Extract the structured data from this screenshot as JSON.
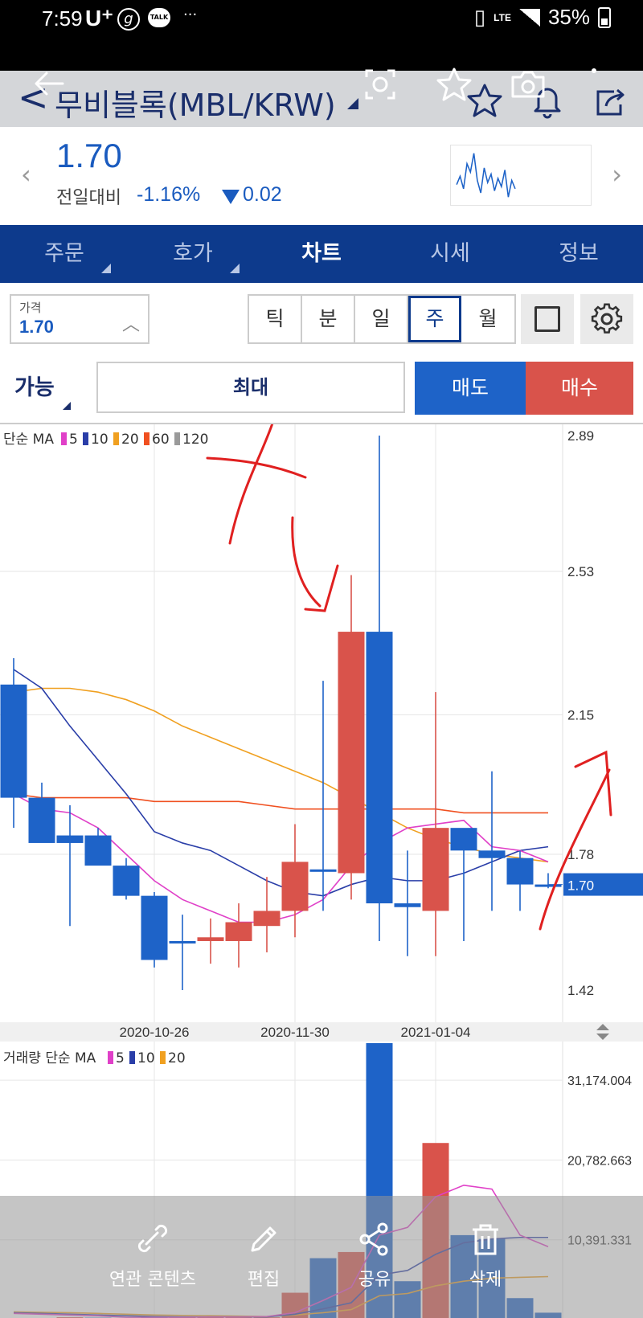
{
  "status_bar": {
    "time": "7:59",
    "carrier": "U⁺",
    "g_icon": "g",
    "talk": "TALK",
    "more": "···",
    "net": "LTE",
    "battery": "35%"
  },
  "header": {
    "title": "무비블록(MBL/KRW)"
  },
  "price": {
    "current": "1.70",
    "change_label": "전일대비",
    "change_pct": "-1.16%",
    "change_value": "0.02"
  },
  "mini_chart": [
    1.78,
    1.82,
    1.76,
    1.88,
    1.84,
    1.93,
    1.8,
    1.74,
    1.86,
    1.79,
    1.83,
    1.75,
    1.81,
    1.77,
    1.85,
    1.72,
    1.8,
    1.76
  ],
  "tabs": [
    {
      "label": "주문",
      "corner": true
    },
    {
      "label": "호가",
      "corner": true
    },
    {
      "label": "차트",
      "active": true
    },
    {
      "label": "시세"
    },
    {
      "label": "정보"
    }
  ],
  "controls": {
    "price_label": "가격",
    "price_value": "1.70",
    "periods": [
      "틱",
      "분",
      "일",
      "주",
      "월"
    ],
    "active_period": "주"
  },
  "order": {
    "available": "가능",
    "max": "최대",
    "sell": "매도",
    "buy": "매수"
  },
  "colors": {
    "up": "#d9534b",
    "down": "#1e63c8",
    "ma5": "#e040c8",
    "ma10": "#2a3ea8",
    "ma20": "#f0a020",
    "ma60": "#f05020",
    "ma120": "#9a9a9a",
    "brand": "#0d3a8c"
  },
  "chart_data": {
    "type": "candlestick",
    "price_panel": {
      "legend": {
        "prefix": "단순 MA",
        "items": [
          {
            "label": "5",
            "color": "#e040c8"
          },
          {
            "label": "10",
            "color": "#2a3ea8"
          },
          {
            "label": "20",
            "color": "#f0a020"
          },
          {
            "label": "60",
            "color": "#f05020"
          },
          {
            "label": "120",
            "color": "#9a9a9a"
          }
        ]
      },
      "y_ticks": [
        "2.89",
        "2.53",
        "2.15",
        "1.78",
        "1.42"
      ],
      "ylim": [
        1.42,
        2.89
      ],
      "current_label": "1.70",
      "x_ticks": [
        "2020-10-26",
        "2020-11-30",
        "2021-01-04"
      ],
      "candles": [
        {
          "o": 2.23,
          "h": 2.3,
          "l": 1.85,
          "c": 1.93
        },
        {
          "o": 1.93,
          "h": 1.97,
          "l": 1.82,
          "c": 1.81
        },
        {
          "o": 1.83,
          "h": 1.91,
          "l": 1.59,
          "c": 1.81
        },
        {
          "o": 1.83,
          "h": 1.85,
          "l": 1.76,
          "c": 1.75
        },
        {
          "o": 1.75,
          "h": 1.77,
          "l": 1.66,
          "c": 1.67
        },
        {
          "o": 1.67,
          "h": 1.68,
          "l": 1.48,
          "c": 1.5
        },
        {
          "o": 1.55,
          "h": 1.62,
          "l": 1.42,
          "c": 1.55
        },
        {
          "o": 1.55,
          "h": 1.61,
          "l": 1.49,
          "c": 1.56
        },
        {
          "o": 1.55,
          "h": 1.65,
          "l": 1.48,
          "c": 1.6
        },
        {
          "o": 1.59,
          "h": 1.72,
          "l": 1.52,
          "c": 1.63
        },
        {
          "o": 1.63,
          "h": 1.86,
          "l": 1.56,
          "c": 1.76
        },
        {
          "o": 1.74,
          "h": 2.24,
          "l": 1.63,
          "c": 1.74
        },
        {
          "o": 1.73,
          "h": 2.52,
          "l": 1.66,
          "c": 2.37
        },
        {
          "o": 2.37,
          "h": 2.89,
          "l": 1.55,
          "c": 1.65
        },
        {
          "o": 1.65,
          "h": 1.79,
          "l": 1.51,
          "c": 1.64
        },
        {
          "o": 1.63,
          "h": 2.21,
          "l": 1.51,
          "c": 1.85
        },
        {
          "o": 1.85,
          "h": 1.84,
          "l": 1.55,
          "c": 1.79
        },
        {
          "o": 1.79,
          "h": 2.0,
          "l": 1.63,
          "c": 1.77
        },
        {
          "o": 1.77,
          "h": 1.79,
          "l": 1.63,
          "c": 1.7
        },
        {
          "o": 1.7,
          "h": 1.73,
          "l": 1.69,
          "c": 1.7
        }
      ],
      "ma5": [
        1.94,
        1.9,
        1.89,
        1.85,
        1.78,
        1.71,
        1.66,
        1.63,
        1.6,
        1.6,
        1.62,
        1.66,
        1.75,
        1.81,
        1.85,
        1.86,
        1.87,
        1.8,
        1.79,
        1.76
      ],
      "ma10": [
        2.27,
        2.22,
        2.12,
        2.03,
        1.94,
        1.84,
        1.81,
        1.79,
        1.75,
        1.71,
        1.68,
        1.67,
        1.7,
        1.72,
        1.71,
        1.71,
        1.73,
        1.76,
        1.79,
        1.8
      ],
      "ma20": [
        2.21,
        2.22,
        2.22,
        2.21,
        2.19,
        2.16,
        2.12,
        2.09,
        2.06,
        2.03,
        2.0,
        1.97,
        1.93,
        1.89,
        1.85,
        1.82,
        1.8,
        1.78,
        1.77,
        1.76
      ],
      "ma60": [
        1.94,
        1.93,
        1.93,
        1.93,
        1.93,
        1.92,
        1.92,
        1.92,
        1.92,
        1.91,
        1.9,
        1.9,
        1.9,
        1.9,
        1.9,
        1.9,
        1.89,
        1.89,
        1.89,
        1.89
      ]
    },
    "volume_panel": {
      "legend": {
        "prefix": "거래량 단순 MA",
        "items": [
          {
            "label": "5",
            "color": "#e040c8"
          },
          {
            "label": "10",
            "color": "#2a3ea8"
          },
          {
            "label": "20",
            "color": "#f0a020"
          }
        ]
      },
      "y_ticks": [
        "31,174.004",
        "20,782.663",
        "10,391.331"
      ],
      "bars": [
        {
          "v": 200,
          "up": false
        },
        {
          "v": 150,
          "up": false
        },
        {
          "v": 300,
          "up": true
        },
        {
          "v": 250,
          "up": false
        },
        {
          "v": 200,
          "up": false
        },
        {
          "v": 300,
          "up": false
        },
        {
          "v": 400,
          "up": true
        },
        {
          "v": 300,
          "up": true
        },
        {
          "v": 450,
          "up": true
        },
        {
          "v": 300,
          "up": true
        },
        {
          "v": 3500,
          "up": true
        },
        {
          "v": 8000,
          "up": false
        },
        {
          "v": 8800,
          "up": true
        },
        {
          "v": 36000,
          "up": false
        },
        {
          "v": 5000,
          "up": false
        },
        {
          "v": 23000,
          "up": true
        },
        {
          "v": 11000,
          "up": false
        },
        {
          "v": 10500,
          "up": false
        },
        {
          "v": 2800,
          "up": false
        },
        {
          "v": 900,
          "up": false
        }
      ],
      "ma5": [
        800,
        700,
        600,
        500,
        300,
        300,
        300,
        350,
        350,
        400,
        900,
        2500,
        4200,
        11000,
        12000,
        16000,
        17500,
        17000,
        11000,
        9500
      ],
      "ma10": [
        900,
        800,
        700,
        600,
        500,
        400,
        350,
        350,
        350,
        350,
        700,
        1400,
        2200,
        5800,
        6400,
        8500,
        10000,
        10500,
        10700,
        10700
      ],
      "ma20": [
        1000,
        950,
        900,
        800,
        700,
        600,
        550,
        500,
        450,
        400,
        600,
        900,
        1300,
        3100,
        3400,
        4400,
        5000,
        5400,
        5500,
        5600
      ]
    }
  },
  "actions": [
    {
      "label": "연관 콘텐츠",
      "icon": "link-icon"
    },
    {
      "label": "편집",
      "icon": "pencil-icon"
    },
    {
      "label": "공유",
      "icon": "share-icon"
    },
    {
      "label": "삭제",
      "icon": "trash-icon"
    }
  ]
}
